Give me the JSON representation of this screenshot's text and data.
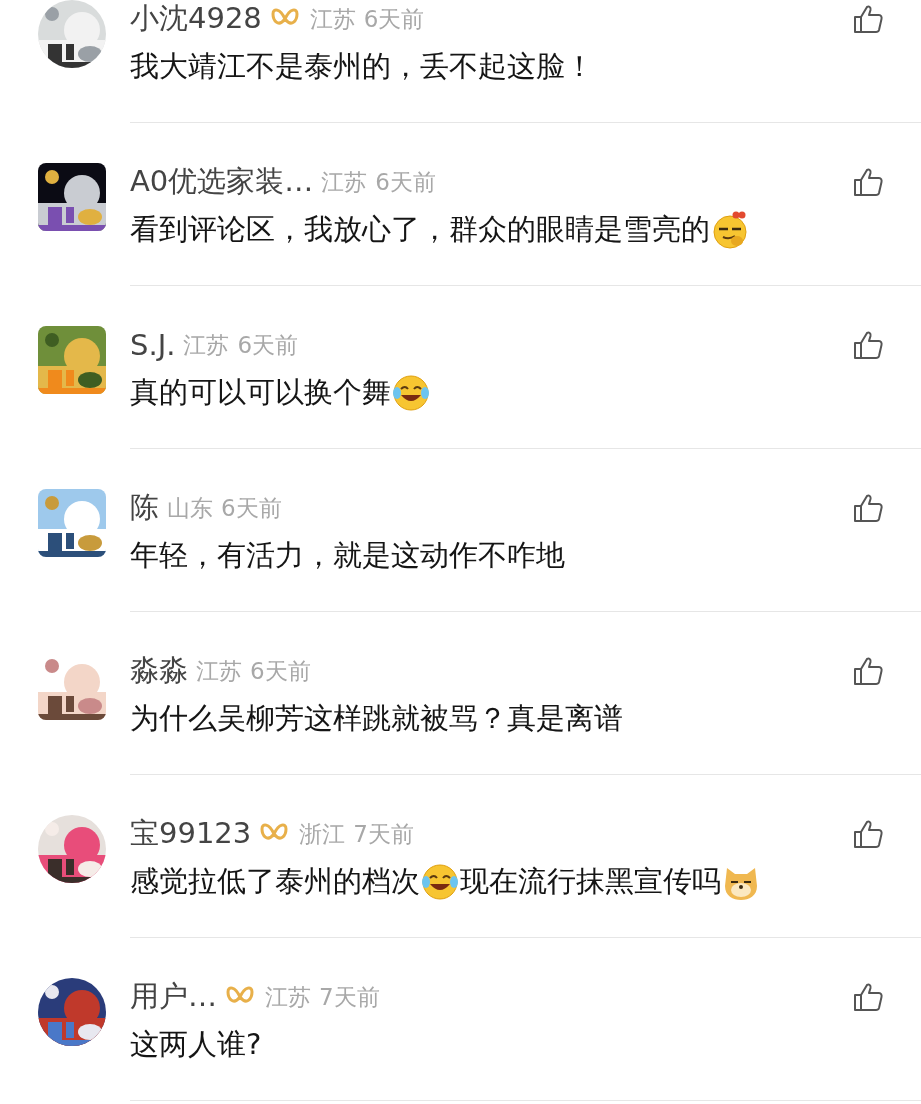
{
  "comments": [
    {
      "avatar_round": true,
      "name": "小沈4928",
      "vip": true,
      "region": "江苏",
      "time": "6天前",
      "parts": [
        {
          "kind": "text",
          "text": "我大靖江不是泰州的，丢不起这脸！"
        }
      ]
    },
    {
      "avatar_round": false,
      "name": "A0优选家装…",
      "vip": false,
      "region": "江苏",
      "time": "6天前",
      "parts": [
        {
          "kind": "text",
          "text": "看到评论区，我放心了，群众的眼睛是雪亮的"
        },
        {
          "kind": "smirk"
        }
      ]
    },
    {
      "avatar_round": false,
      "name": "S.J.",
      "vip": false,
      "region": "江苏",
      "time": "6天前",
      "parts": [
        {
          "kind": "text",
          "text": "真的可以可以换个舞"
        },
        {
          "kind": "laugh"
        }
      ]
    },
    {
      "avatar_round": false,
      "name": "陈",
      "vip": false,
      "region": "山东",
      "time": "6天前",
      "parts": [
        {
          "kind": "text",
          "text": "年轻，有活力，就是这动作不咋地"
        }
      ]
    },
    {
      "avatar_round": false,
      "name": "淼淼",
      "vip": false,
      "region": "江苏",
      "time": "6天前",
      "parts": [
        {
          "kind": "text",
          "text": "为什么吴柳芳这样跳就被骂？真是离谱"
        }
      ]
    },
    {
      "avatar_round": true,
      "name": "宝99123",
      "vip": true,
      "region": "浙江",
      "time": "7天前",
      "parts": [
        {
          "kind": "text",
          "text": "感觉拉低了泰州的档次"
        },
        {
          "kind": "laugh"
        },
        {
          "kind": "text",
          "text": "现在流行抹黑宣传吗"
        },
        {
          "kind": "dog"
        }
      ]
    },
    {
      "avatar_round": true,
      "name": "用户…",
      "vip": true,
      "region": "江苏",
      "time": "7天前",
      "parts": [
        {
          "kind": "text",
          "text": "这两人谁?"
        }
      ]
    }
  ]
}
